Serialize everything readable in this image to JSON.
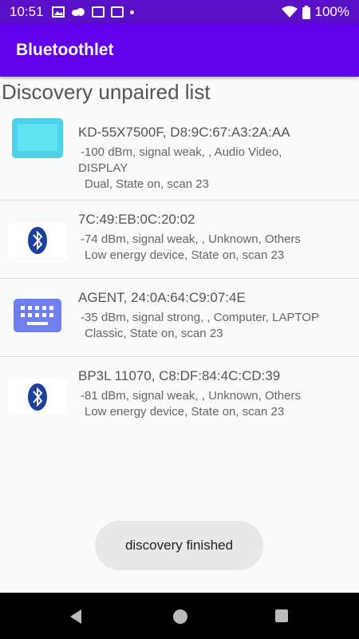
{
  "status": {
    "time": "10:51",
    "battery": "100%"
  },
  "app": {
    "title": "Bluetoothlet"
  },
  "section": {
    "title": "Discovery unpaired list"
  },
  "devices": [
    {
      "icon": "tv-icon",
      "title": "KD-55X7500F, D8:9C:67:A3:2A:AA",
      "line1": "-100 dBm, signal weak, ,  Audio Video,",
      "line2": "DISPLAY",
      "line3": "Dual,  State on,  scan 23"
    },
    {
      "icon": "bluetooth-icon",
      "title": "7C:49:EB:0C:20:02",
      "line1": "-74 dBm, signal weak, ,  Unknown,  Others",
      "line2": "Low energy device,  State on, scan 23"
    },
    {
      "icon": "keyboard-icon",
      "title": "AGENT, 24:0A:64:C9:07:4E",
      "line1": "-35 dBm, signal strong, ,  Computer,  LAPTOP",
      "line2": "Classic,  State on, scan 23"
    },
    {
      "icon": "bluetooth-icon",
      "title": "BP3L 11070, C8:DF:84:4C:CD:39",
      "line1": "-81 dBm, signal weak, ,  Unknown,  Others",
      "line2": "Low energy device,  State on, scan 23"
    }
  ],
  "toast": {
    "text": "discovery finished"
  },
  "colors": {
    "primary": "#6200ee",
    "status_bar": "#5a0fc8",
    "tv_icon": "#4dd0e8",
    "keyboard_icon": "#6f7ff0",
    "bluetooth": "#1d3f9f"
  }
}
